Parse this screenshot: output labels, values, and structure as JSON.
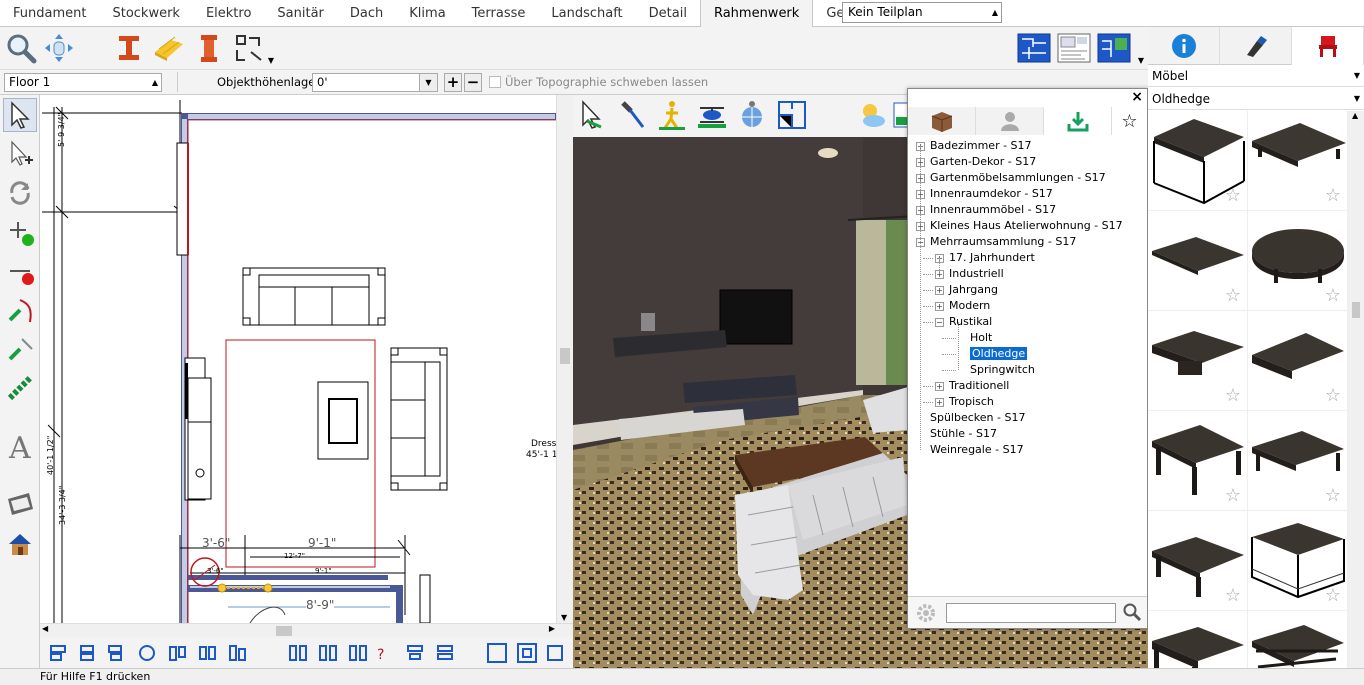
{
  "tabs": [
    "Fundament",
    "Stockwerk",
    "Elektro",
    "Sanitär",
    "Dach",
    "Klima",
    "Terrasse",
    "Landschaft",
    "Detail",
    "Rahmenwerk",
    "Gelände"
  ],
  "active_tab": "Rahmenwerk",
  "teilplan": {
    "value": "Kein Teilplan"
  },
  "propbar": {
    "floor": "Floor 1",
    "objekt_label": "Objekthöhenlage:",
    "objekt_value": "0'",
    "plus": "+",
    "minus": "−",
    "checkbox_label": "Über Topographie schweben lassen"
  },
  "plan": {
    "dims": {
      "d1": "5'-9 3/4\"",
      "d2": "40'-1 1/2\"",
      "d3": "34'-3 3/4\"",
      "d4": "3'-6\"",
      "d5": "9'-1\"",
      "d6": "12'-7\"",
      "d7": "9'-1\"",
      "d8": "8'-9\"",
      "d9": "3'-6\"",
      "dress1": "Dress",
      "dress2": "45'-1 1"
    }
  },
  "library": {
    "close": "×",
    "star": "☆",
    "tree": [
      {
        "label": "Badezimmer - S17",
        "level": 0,
        "toggle": "+"
      },
      {
        "label": "Garten-Dekor - S17",
        "level": 0,
        "toggle": "+"
      },
      {
        "label": "Gartenmöbelsammlungen - S17",
        "level": 0,
        "toggle": "+"
      },
      {
        "label": "Innenraumdekor - S17",
        "level": 0,
        "toggle": "+"
      },
      {
        "label": "Innenraummöbel - S17",
        "level": 0,
        "toggle": "+"
      },
      {
        "label": "Kleines Haus Atelierwohnung - S17",
        "level": 0,
        "toggle": "+"
      },
      {
        "label": "Mehrraumsammlung - S17",
        "level": 0,
        "toggle": "−"
      },
      {
        "label": "17. Jahrhundert",
        "level": 1,
        "toggle": "+"
      },
      {
        "label": "Industriell",
        "level": 1,
        "toggle": "+"
      },
      {
        "label": "Jahrgang",
        "level": 1,
        "toggle": "+"
      },
      {
        "label": "Modern",
        "level": 1,
        "toggle": "+"
      },
      {
        "label": "Rustikal",
        "level": 1,
        "toggle": "−"
      },
      {
        "label": "Holt",
        "level": 2,
        "toggle": ""
      },
      {
        "label": "Oldhedge",
        "level": 2,
        "toggle": "",
        "selected": true
      },
      {
        "label": "Springwitch",
        "level": 2,
        "toggle": ""
      },
      {
        "label": "Traditionell",
        "level": 1,
        "toggle": "+"
      },
      {
        "label": "Tropisch",
        "level": 1,
        "toggle": "+"
      },
      {
        "label": "Spülbecken - S17",
        "level": 0,
        "toggle": ""
      },
      {
        "label": "Stühle - S17",
        "level": 0,
        "toggle": ""
      },
      {
        "label": "Weinregale - S17",
        "level": 0,
        "toggle": ""
      }
    ],
    "search_value": ""
  },
  "right": {
    "category": "Möbel",
    "collection": "Oldhedge",
    "thumb_star": "☆"
  },
  "status": "Für Hilfe F1 drücken",
  "colors": {
    "accent": "#0a6bd3",
    "wall": "#3c4a8a",
    "plan_red": "#c0151c"
  }
}
